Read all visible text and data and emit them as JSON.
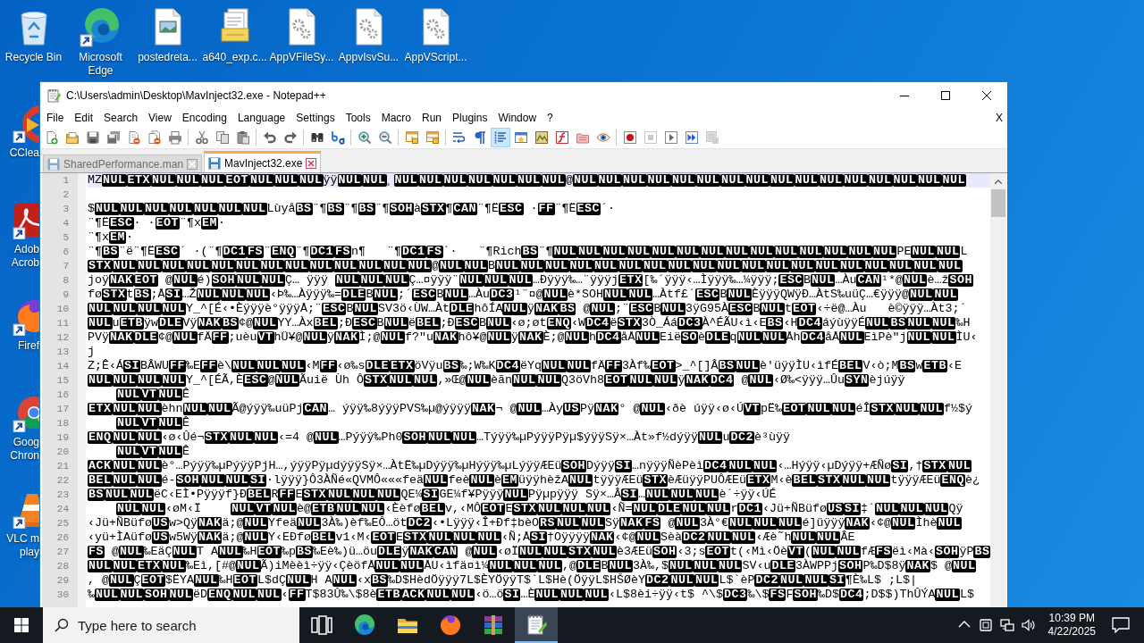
{
  "desktop": {
    "icons": [
      {
        "label": "Recycle Bin",
        "kind": "recycle-bin",
        "shortcut": false
      },
      {
        "label": "Microsoft Edge",
        "kind": "edge",
        "shortcut": true
      },
      {
        "label": "postedreta...",
        "kind": "image-file",
        "shortcut": false
      },
      {
        "label": "a640_exp.c...",
        "kind": "document-stack",
        "shortcut": false
      },
      {
        "label": "AppVFileSy...",
        "kind": "gear-file",
        "shortcut": false
      },
      {
        "label": "AppvIsvSu...",
        "kind": "gear-file",
        "shortcut": false
      },
      {
        "label": "AppVScript...",
        "kind": "gear-file",
        "shortcut": false
      }
    ],
    "side_icons": [
      {
        "label_lines": [
          "CClea"
        ],
        "kind": "ccleaner",
        "shortcut": true
      },
      {
        "label_lines": [
          "Adob",
          "Acrob"
        ],
        "kind": "acrobat",
        "shortcut": true
      },
      {
        "label_lines": [
          "Firef"
        ],
        "kind": "firefox",
        "shortcut": true
      },
      {
        "label_lines": [
          "Goog",
          "Chron"
        ],
        "kind": "chrome",
        "shortcut": true
      },
      {
        "label_lines": [
          "VLC m",
          "play"
        ],
        "kind": "vlc",
        "shortcut": true
      }
    ]
  },
  "window": {
    "title": "C:\\Users\\admin\\Desktop\\MavInject32.exe - Notepad++",
    "menu": [
      "File",
      "Edit",
      "Search",
      "View",
      "Encoding",
      "Language",
      "Settings",
      "Tools",
      "Macro",
      "Run",
      "Plugins",
      "Window",
      "?"
    ],
    "menu_close": "X",
    "toolbar": [
      [
        {
          "kind": "new",
          "pressed": false,
          "disabled": false
        },
        {
          "kind": "open",
          "pressed": false,
          "disabled": false
        },
        {
          "kind": "save",
          "pressed": false,
          "disabled": false
        },
        {
          "kind": "saveall",
          "pressed": false,
          "disabled": false
        },
        {
          "kind": "close",
          "pressed": false,
          "disabled": false
        },
        {
          "kind": "closeall",
          "pressed": false,
          "disabled": false
        },
        {
          "kind": "print",
          "pressed": false,
          "disabled": false
        }
      ],
      [
        {
          "kind": "cut",
          "pressed": false,
          "disabled": false
        },
        {
          "kind": "copy",
          "pressed": false,
          "disabled": false
        },
        {
          "kind": "paste",
          "pressed": false,
          "disabled": false
        }
      ],
      [
        {
          "kind": "undo",
          "pressed": false,
          "disabled": false
        },
        {
          "kind": "redo",
          "pressed": false,
          "disabled": false
        }
      ],
      [
        {
          "kind": "find",
          "pressed": false,
          "disabled": false
        },
        {
          "kind": "replace",
          "pressed": false,
          "disabled": false
        }
      ],
      [
        {
          "kind": "zoomin",
          "pressed": false,
          "disabled": false
        },
        {
          "kind": "zoomout",
          "pressed": false,
          "disabled": false
        }
      ],
      [
        {
          "kind": "syncv",
          "pressed": false,
          "disabled": false
        },
        {
          "kind": "synch",
          "pressed": false,
          "disabled": false
        }
      ],
      [
        {
          "kind": "wrap",
          "pressed": false,
          "disabled": false
        },
        {
          "kind": "allchars",
          "pressed": false,
          "disabled": false
        },
        {
          "kind": "indent",
          "pressed": true,
          "disabled": false
        },
        {
          "kind": "lang",
          "pressed": false,
          "disabled": false
        },
        {
          "kind": "docmap",
          "pressed": false,
          "disabled": false
        },
        {
          "kind": "funclist",
          "pressed": false,
          "disabled": false
        },
        {
          "kind": "folder",
          "pressed": false,
          "disabled": false
        },
        {
          "kind": "monitor",
          "pressed": false,
          "disabled": false
        }
      ],
      [
        {
          "kind": "record",
          "pressed": false,
          "disabled": false
        },
        {
          "kind": "stop",
          "pressed": false,
          "disabled": true
        },
        {
          "kind": "play",
          "pressed": false,
          "disabled": false
        },
        {
          "kind": "playmulti",
          "pressed": false,
          "disabled": false
        },
        {
          "kind": "savemacro",
          "pressed": false,
          "disabled": true
        }
      ]
    ],
    "tabs": [
      {
        "label": "SharedPerformance.man",
        "selected": false
      },
      {
        "label": "MavInject32.exe",
        "selected": true
      }
    ],
    "editor": {
      "lines": [
        {
          "number": "1",
          "current": true,
          "text": "MZ**NUL****ETX****NUL****NUL****NUL****EOT****NUL****NUL****NUL**ÿÿ**NUL****NUL**¸**NUL****NUL****NUL****NUL****NUL****NUL****NUL**@**NUL****NUL****NUL****NUL****NUL****NUL****NUL****NUL****NUL****NUL****NUL****NUL****NUL****NUL****NUL****NUL**"
        },
        {
          "number": "2",
          "current": false
        },
        {
          "number": "3",
          "current": false,
          "text": "$**NUL****NUL****NUL****NUL****NUL****NUL****NUL**Lùyå**BS**¨¶**BS**¨¶**BS**¨¶**SOH**à**STX**¶**CAN**¨¶Ë**ESC** ·**FF**¨¶Ë**ESC**´·"
        },
        {
          "number": "4",
          "current": false,
          "text": "¨¶Ë**ESC**· ·**EOT**¨¶x**EM**·"
        },
        {
          "number": "5",
          "current": false,
          "text": "¨¶x**EM**·"
        },
        {
          "number": "6",
          "current": false,
          "text": "¨¶**BS**¨ë¨¶Ë**ESC**´ ·(¨¶**DC1****FS**¨**ENQ**¨¶**DC1****FS**n¶   ¨¶**DC1****FS**`·   ¨¶Rich**BS**¨¶**NUL****NUL****NUL****NUL****NUL****NUL****NUL****NUL****NUL****NUL****NUL****NUL****NUL****NUL**PE**NUL****NUL**L"
        },
        {
          "number": "7",
          "current": false,
          "text": "**STX****NUL****NUL****NUL****NUL****NUL****NUL****NUL****NUL****NUL****NUL****NUL****NUL****NUL**@**NUL****NUL**B**NUL****NUL****NUL****NUL****NUL****NUL****NUL****NUL****NUL****NUL****NUL****NUL****NUL****NUL****NUL****NUL****NUL****NUL****NUL**"
        },
        {
          "number": "8",
          "current": false,
          "text": "joÿ**NAK****EOT** @**NUL**é)**SOH****NUL****NUL**Ç… ÿÿÿ **NUL****NUL****NUL**Ç…¤ÿÿÿ¨**NUL****NUL****NUL**…Ðÿÿÿ‰…¨ÿÿÿj**ETX**[‰´ÿÿÿ‹…Ìÿÿÿ‰…¼ÿÿÿ;**ESC**B**NUL**…Àu**CAN**¹*@**NUL**è…ž**SOH**"
        },
        {
          "number": "9",
          "current": false,
          "text": "fø**STX**t**BS**;Å**SI**…Ž**NUL****NUL****NUL**‹Þ‰…Àÿÿÿ‰=**DLE**B**NUL**;´**ESC**B**NUL**…Àu**DC3**¹¨¤@**NUL**è*SOH**NUL****NUL**…Àtf£´**ESC**B**NUL**ÈÿÿÿQWÿÐ…ÀtS‰uüÇ…€ÿÿÿ@**NUL****NUL**"
        },
        {
          "number": "10",
          "current": false,
          "text": "**NUL****NUL****NUL****NUL**Y_^[É‹•Èÿÿÿè°ÿÿÿÅ;¨**ESC**B**NUL**SV3ö‹ÙW…Àt**DLE**hôÍA**NUL**ÿ**NAK****BS** @**NUL**;¨**ESC**B**NUL**3ÿG95À**ESC**B**NUL**t**EOT**‹÷ë@…Àu   è©ÿÿÿ…Àt3;´"
        },
        {
          "number": "11",
          "current": false,
          "text": "**NUL**u**ETB**ÿw**DLE**Vÿ**NAK****BS**¢@**NUL**YY…Àx**BEL**;Ð**ESC**B**NUL**ë**BEL**;Ð**ESC**B**NUL**‹ø;øt**ENQ**‹W**DC4**ë**STX**3Ò_Áá**DC3**À^ÉÃU‹ì‹E**BS**‹H**DC4**áýùÿÿÉ**NUL****BS****NUL****NUL**‰H"
        },
        {
          "number": "12",
          "current": false,
          "text": "PVÿ**NAK****DLE**¢@**NUL**fÄ**FF**;uèu**VT**hÜ¥@**NUL**ÿ**NAK**Ì;@**NUL**f?\"u**NAK**hô¥@**NUL**ÿ**NAK**È;@**NUL**h**DC4**åÅ**NUL**Eië**SO**è**DLE**q**NUL****NUL**Åh**DC4**åÅ**NUL**EìPè\"j**NUL****NUL**ÌU‹"
        },
        {
          "number": "13",
          "current": false,
          "text": "j"
        },
        {
          "number": "14",
          "current": false,
          "text": "Z;Ê‹Á**SI**BÂWU**FF**‰E**FF**è\\**NUL****NUL****NUL**‹M**FF**‹ø‰s**DLE****ETX**öVÿu**BS**‰;W‰K**DC4**ëYq**NUL****NUL**fÄ**FF**3Àf‰**EOT**>_^[]Â**BS****NUL**è'üÿÿÌU‹ìfÉ**BEL**V‹ò;M**BS**w**ETB**‹E"
        },
        {
          "number": "15",
          "current": false,
          "text": "**NUL****NUL****NUL****NUL**Y_^[ÉÃ,È**ESC**@**NUL**Ãuië Ùh Ô**STX****NUL****NUL**,»Œ@**NUL**èãn**NUL****NUL**Q3öVh8**EOT****NUL****NUL**ÿ**NAK****DC4** @**NUL**‹Ø‰<ÿÿÿ…Ûu**SYN**èjúÿÿ"
        },
        {
          "number": "16",
          "current": false,
          "text": "\t**NUL****VT****NUL**Ê"
        },
        {
          "number": "17",
          "current": false,
          "text": "**ETX****NUL****NUL**èhn**NUL****NUL**Ã@ýÿÿ‰uüPj**CAN**… ýÿÿ‰8ýÿÿPVS‰µ@ýÿÿÿ**NAK**¬ @**NUL**…Ày**US**Pÿ**NAK**° @**NUL**‹ðè úÿÿ‹ø‹Ú**VT**pË‰**EOT****NUL****NUL**éÎ**STX****NUL****NUL**f½$ý"
        },
        {
          "number": "18",
          "current": false,
          "text": "\t**NUL****VT****NUL**Ê"
        },
        {
          "number": "19",
          "current": false,
          "text": "**ENQ****NUL****NUL**‹ø‹Ûé¬**STX****NUL****NUL**‹=4 @**NUL**…Pýÿÿ‰Ph0**SOH****NUL****NUL**…Týÿÿ‰µPýÿÿPÿµ$ýÿÿSÿ×…Àt»f½dýÿÿ**NUL**u**DC2**è³ùÿÿ"
        },
        {
          "number": "20",
          "current": false,
          "text": "\t**NUL****VT****NUL**Ê"
        },
        {
          "number": "21",
          "current": false,
          "text": "**ACK****NUL****NUL**è°…Pýÿÿ‰µPýÿÿPjH…,ýÿÿPÿµdýÿÿSÿ×…ÀtË‰µDýÿÿ‰µHýÿÿ‰µLýÿÿÆEü**SOH**Dýÿÿ**SI**…nÿÿÿÑèPèì**DC4****NUL****NUL**‹…Hýÿÿ‹µDýÿÿ+ÆÑø**SI**,†**STX****NUL**"
        },
        {
          "number": "22",
          "current": false,
          "text": "**BEL****NUL****NUL**é-**SOH****NUL****NUL****SI**·lÿÿÿ}Ô3ÀÑé«QVMÔ«««feä**NUL**feè**NUL**è**EM**üÿÿhèžA**NUL**tÿÿÿÆEü**STX**èÆüÿÿPUÔÆEü**ETX**M‹è**BEL****STX****NUL****NUL**tÿÿÿÆEü**ENQ**è¿"
        },
        {
          "number": "23",
          "current": false,
          "text": "**BS****NUL****NUL**ëC‹EÌ•Pÿÿÿf}Ð**BEL**R**FF**E**STX****NUL****NUL****NUL**QE¼**SI**GE¼f¥Pÿÿÿ**NUL**Pÿµpÿÿÿ Sÿ×…Â**SI**…**NUL****NUL****NUL**è´÷ÿÿ‹ÚÉ"
        },
        {
          "number": "24",
          "current": false,
          "text": "\t**NUL****NUL**‹øM‹Ï\t**NUL****VT****NUL**è@**ETB****NUL****NUL**‹Èèfø**BEL**v,‹MÔ**EOT**E**STX****NUL****NUL****NUL**‹Ñ=**NUL****DLE****NUL****NUL**r**DC1**‹Jü+ÑBüfø**US****SI**‡´**NUL****NUL****NUL**Qÿ"
        },
        {
          "number": "25",
          "current": false,
          "text": "‹Jü+ÑBüfø**US**w>Qÿ**NAK**ä;@**NUL**Yfeä**NUL**3À‰)èf‰EÔ…öt**DC2**‹•Lÿÿÿ‹Î+Ðf‡bèO**RS****NUL****NUL**Sÿ**NAK****FS** @**NUL**3À°€**NUL****NUL****NUL**é]üÿÿÿ**NAK**‹¢@**NUL**Ìhè**NUL**"
        },
        {
          "number": "26",
          "current": false,
          "text": "‹yü+ÌAüfø**US**w5Wÿ**NAK**ä;@**NUL**Y‹EÐfø**BEL**v1‹M‹**EOT**E**STX****NUL****NUL****NUL**‹Ñ;Å**SI**†Oÿÿÿÿ**NAK**‹¢@**NUL**Sèà**DC2****NUL****NUL**‹Æè˜h**NUL****NUL**ÂE"
        },
        {
          "number": "27",
          "current": false,
          "text": "**FS** @**NUL**‰EäÇ**NUL**T A**NUL**‰H**EOT**‰p**BS**‰Eè‰)ü…öu**DLE**ÿ**NAK****CAN** @**NUL**‹øÏ**NUL****NUL****STX****NUL**è3ÆEü**SOH**‹3;s**EOT**t(‹Mì‹Öè**VT**(**NUL****NUL**fÆ**FS**ëì‹Mà‹**SOH**ÿP**BS**"
        },
        {
          "number": "28",
          "current": false,
          "text": "**NUL****NUL****ETX****NUL**‰Eì,[#@**NUL**Ã)iMèèì÷ÿÿ‹ÇèöfÅ**NUL****NUL**ÅU‹ìfä¤ì¼**NUL****NUL****NUL**,@**DLE**B**NUL**3À‰,$**NUL****NUL****NUL**SV‹u**DLE**3ÀWPPj**SOH**P‰D$8ÿ**NAK**$ @**NUL**"
        },
        {
          "number": "29",
          "current": false,
          "text": ", @**NUL**Ç**EOT**$ËYA**NUL**‰H**EOT**L$dÇ**NUL**H A**NUL**‹x**BS**‰D$HèdÖÿÿÿ7L$ÈYÖÿÿT$`L$Hè(ÖÿÿL$HŠØèY**DC2****NUL****NUL**L$`èP**DC2****NUL****NUL****SI**¶È‰L$ ;L$|"
        },
        {
          "number": "30",
          "current": false,
          "text": "‰**NUL****NUL****SOH****NUL**ëD**ENQ****NUL****NUL**‹**FF**T$83Û‰\\$8è**ETB****ACK****NUL****NUL**‹ö…ö**SI**…È**NUL****NUL****NUL**‹L$8èi÷ÿÿ‹t$ ^\\$**DC3**‰\\$**FS**F**SOH**‰D$**DC4**;D$$)ThÛÝA**NUL**L$"
        }
      ]
    }
  },
  "taskbar": {
    "search": {
      "placeholder": "Type here to search"
    },
    "apps": [
      {
        "kind": "task-view",
        "selected": false
      },
      {
        "kind": "edge",
        "selected": false
      },
      {
        "kind": "explorer",
        "selected": false
      },
      {
        "kind": "firefox",
        "selected": false
      },
      {
        "kind": "winrar",
        "selected": false
      },
      {
        "kind": "notepad",
        "selected": true
      }
    ],
    "tray": [
      {
        "kind": "chevron"
      },
      {
        "kind": "device"
      },
      {
        "kind": "network"
      },
      {
        "kind": "volume"
      }
    ],
    "clock": {
      "time": "10:39 PM",
      "date": "4/22/2025"
    }
  }
}
